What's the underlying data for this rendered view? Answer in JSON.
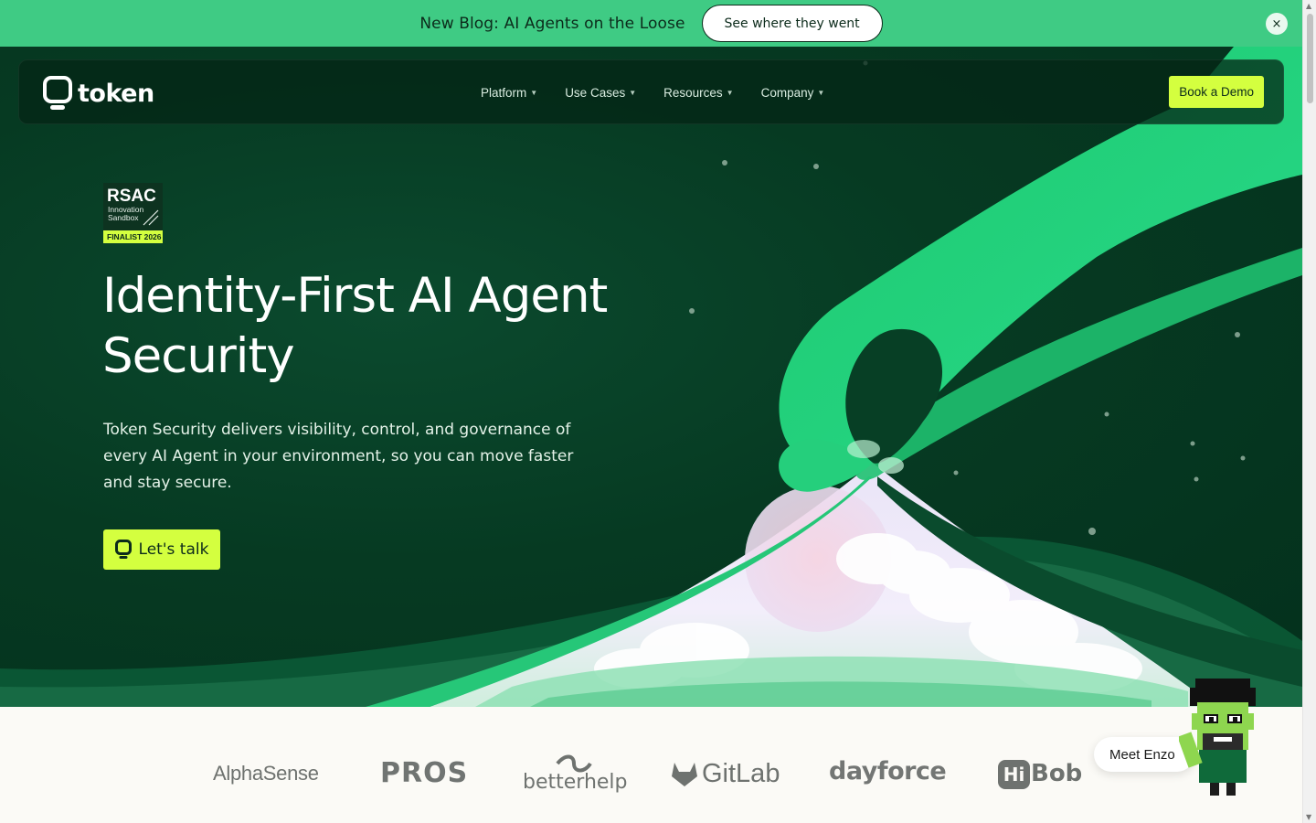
{
  "announcement": {
    "text": "New Blog: AI Agents on the Loose",
    "button_label": "See where they went",
    "close_label": "×"
  },
  "nav": {
    "logo_text": "token",
    "items": [
      {
        "label": "Platform"
      },
      {
        "label": "Use Cases"
      },
      {
        "label": "Resources"
      },
      {
        "label": "Company"
      }
    ],
    "cta_label": "Book a Demo"
  },
  "badge": {
    "line1": "RSAC",
    "line2": "Innovation",
    "line3": "Sandbox",
    "line4": "FINALIST 2026"
  },
  "hero": {
    "headline": "Identity-First AI Agent Security",
    "subcopy": "Token Security delivers visibility, control, and governance of every AI Agent in your environment, so you can move faster and stay secure.",
    "cta_label": "Let's talk"
  },
  "clients": [
    {
      "name": "AlphaSense"
    },
    {
      "name": "PROS"
    },
    {
      "name": "betterhelp"
    },
    {
      "name": "GitLab"
    },
    {
      "name": "dayforce"
    },
    {
      "name": "Bob"
    }
  ],
  "hibob_prefix": "Hi",
  "chat": {
    "bubble_label": "Meet Enzo"
  },
  "colors": {
    "announcement_bg": "#3fcb84",
    "hero_bg": "#063a22",
    "accent": "#d4ff3f",
    "ribbon": "#22d07a"
  }
}
